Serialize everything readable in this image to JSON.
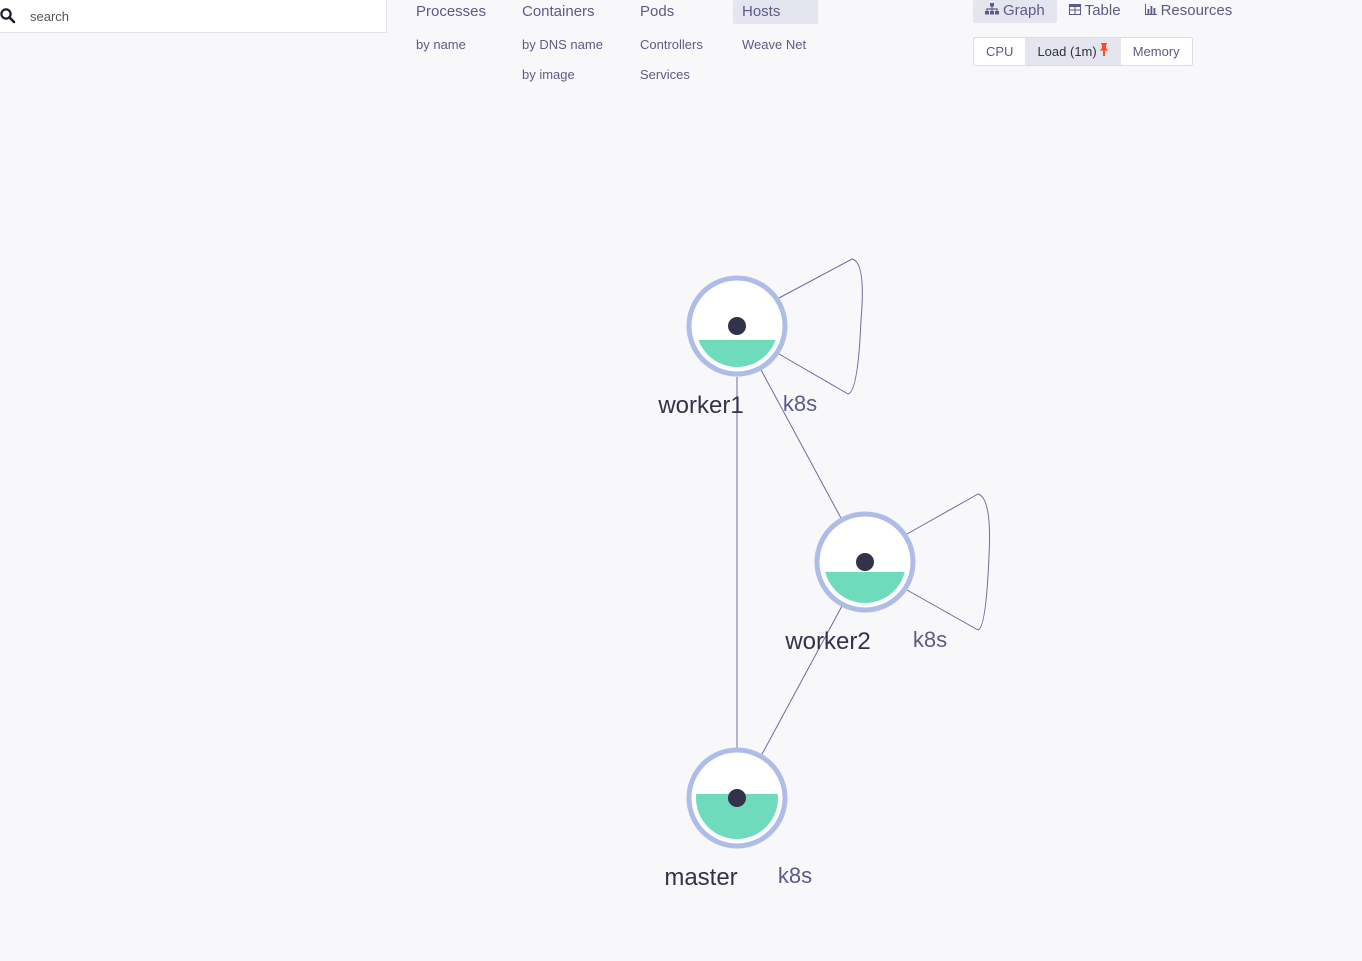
{
  "search": {
    "placeholder": "search"
  },
  "topologies": [
    {
      "label": "Processes",
      "active": false,
      "subs": [
        "by name"
      ]
    },
    {
      "label": "Containers",
      "active": false,
      "subs": [
        "by DNS name",
        "by image"
      ]
    },
    {
      "label": "Pods",
      "active": false,
      "subs": [
        "Controllers",
        "Services"
      ]
    },
    {
      "label": "Hosts",
      "active": true,
      "subs": [
        "Weave Net"
      ]
    }
  ],
  "view_modes": [
    {
      "label": "Graph",
      "icon": "sitemap-icon",
      "active": true
    },
    {
      "label": "Table",
      "icon": "table-icon",
      "active": false
    },
    {
      "label": "Resources",
      "icon": "bar-chart-icon",
      "active": false
    }
  ],
  "metrics": [
    {
      "label": "CPU",
      "active": false,
      "pinned": false
    },
    {
      "label": "Load (1m)",
      "active": true,
      "pinned": true
    },
    {
      "label": "Memory",
      "active": false,
      "pinned": false
    }
  ],
  "colors": {
    "node_ring": "#aebde8",
    "node_fill": "#6fdbbd",
    "edge": "#6b6b9e",
    "pin": "#ff4c1a"
  },
  "graph": {
    "nodes": [
      {
        "id": "worker1",
        "label": "worker1",
        "sublabel": "k8s",
        "load_fill": 0.33
      },
      {
        "id": "worker2",
        "label": "worker2",
        "sublabel": "k8s",
        "load_fill": 0.38
      },
      {
        "id": "master",
        "label": "master",
        "sublabel": "k8s",
        "load_fill": 0.55
      }
    ],
    "edges": [
      {
        "from": "worker1",
        "to": "worker1"
      },
      {
        "from": "worker2",
        "to": "worker2"
      },
      {
        "from": "worker1",
        "to": "master"
      },
      {
        "from": "worker1",
        "to": "worker2"
      },
      {
        "from": "worker2",
        "to": "master"
      }
    ]
  }
}
